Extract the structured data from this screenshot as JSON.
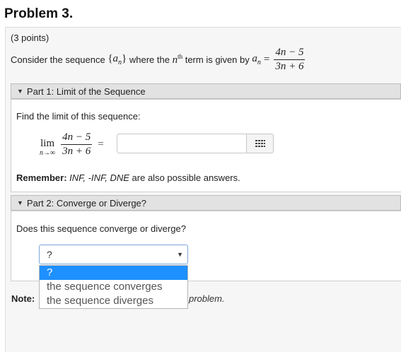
{
  "problem": {
    "title": "Problem 3.",
    "points": "(3 points)",
    "statement_prefix": "Consider the sequence",
    "seq_open": "{",
    "seq_var": "a",
    "seq_sub": "n",
    "seq_close": "}",
    "where_the": "where the",
    "nth_n": "n",
    "nth_sup": "th",
    "term_given": "term is given by",
    "an_var": "a",
    "an_sub": "n",
    "equals": "=",
    "numerator": "4n − 5",
    "denominator": "3n + 6"
  },
  "part1": {
    "header": "Part 1: Limit of the Sequence",
    "prompt": "Find the limit of this sequence:",
    "lim_word": "lim",
    "lim_sub": "n→∞",
    "numerator": "4n − 5",
    "denominator": "3n + 6",
    "equals": "=",
    "answer_value": "",
    "remember_label": "Remember:",
    "remember_values": "INF, -INF, DNE",
    "remember_tail": "are also possible answers."
  },
  "part2": {
    "header": "Part 2: Converge or Diverge?",
    "question": "Does this sequence converge or diverge?",
    "selected": "?",
    "options": [
      "?",
      "the sequence converges",
      "the sequence diverges"
    ]
  },
  "note": {
    "label": "Note:",
    "tail": "problem."
  },
  "icons": {
    "caret": "caret-down-icon",
    "palette": "grid-icon",
    "select_arrow": "chevron-down-icon"
  },
  "colors": {
    "highlight": "#1e90ff",
    "header_bg": "#e2e2e2"
  }
}
